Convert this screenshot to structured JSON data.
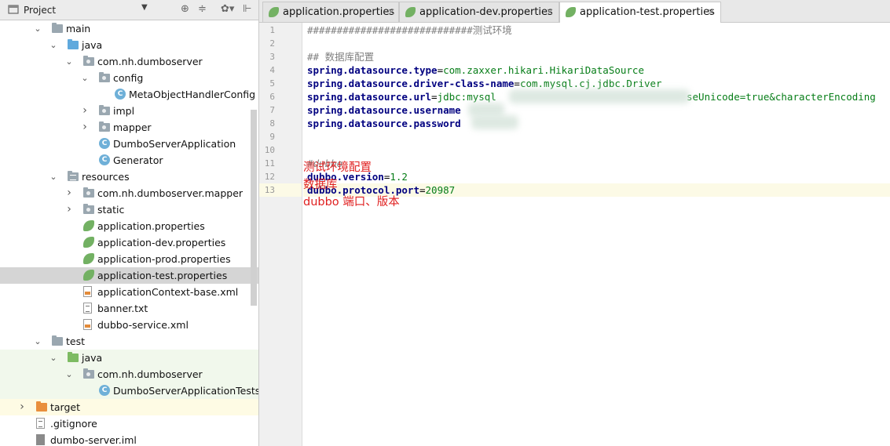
{
  "project_panel": {
    "title": "Project",
    "dropdown_glyph": "▼",
    "tools": [
      "⊕",
      "≑",
      "✿▾",
      "⊩"
    ],
    "tree": [
      {
        "label": "main",
        "indent": 1,
        "arrow": "open",
        "icon": "folder-gray"
      },
      {
        "label": "java",
        "indent": 2,
        "arrow": "open",
        "icon": "folder-blue"
      },
      {
        "label": "com.nh.dumboserver",
        "indent": 3,
        "arrow": "open",
        "icon": "package"
      },
      {
        "label": "config",
        "indent": 4,
        "arrow": "open",
        "icon": "package"
      },
      {
        "label": "MetaObjectHandlerConfig",
        "indent": 5,
        "arrow": "none",
        "icon": "class"
      },
      {
        "label": "impl",
        "indent": 4,
        "arrow": "closed",
        "icon": "package"
      },
      {
        "label": "mapper",
        "indent": 4,
        "arrow": "closed",
        "icon": "package"
      },
      {
        "label": "DumboServerApplication",
        "indent": 4,
        "arrow": "none",
        "icon": "class-spring"
      },
      {
        "label": "Generator",
        "indent": 4,
        "arrow": "none",
        "icon": "class"
      },
      {
        "label": "resources",
        "indent": 2,
        "arrow": "open",
        "icon": "folder-resources"
      },
      {
        "label": "com.nh.dumboserver.mapper",
        "indent": 3,
        "arrow": "closed",
        "icon": "package"
      },
      {
        "label": "static",
        "indent": 3,
        "arrow": "closed",
        "icon": "package"
      },
      {
        "label": "application.properties",
        "indent": 3,
        "arrow": "none",
        "icon": "spring-properties"
      },
      {
        "label": "application-dev.properties",
        "indent": 3,
        "arrow": "none",
        "icon": "spring-properties"
      },
      {
        "label": "application-prod.properties",
        "indent": 3,
        "arrow": "none",
        "icon": "spring-properties"
      },
      {
        "label": "application-test.properties",
        "indent": 3,
        "arrow": "none",
        "icon": "spring-properties",
        "selected": true
      },
      {
        "label": "applicationContext-base.xml",
        "indent": 3,
        "arrow": "none",
        "icon": "xml-file"
      },
      {
        "label": "banner.txt",
        "indent": 3,
        "arrow": "none",
        "icon": "text-file"
      },
      {
        "label": "dubbo-service.xml",
        "indent": 3,
        "arrow": "none",
        "icon": "xml-file"
      },
      {
        "label": "test",
        "indent": 1,
        "arrow": "open",
        "icon": "folder-gray"
      },
      {
        "label": "java",
        "indent": 2,
        "arrow": "open",
        "icon": "folder-green",
        "test": true
      },
      {
        "label": "com.nh.dumboserver",
        "indent": 3,
        "arrow": "open",
        "icon": "package",
        "test": true
      },
      {
        "label": "DumboServerApplicationTests",
        "indent": 4,
        "arrow": "none",
        "icon": "class-spring",
        "test": true
      },
      {
        "label": "target",
        "indent": 0,
        "arrow": "closed",
        "icon": "folder-orange",
        "excluded": true
      },
      {
        "label": ".gitignore",
        "indent": 0,
        "arrow": "none",
        "icon": "text-file"
      },
      {
        "label": "dumbo-server.iml",
        "indent": 0,
        "arrow": "none",
        "icon": "iml-file"
      }
    ]
  },
  "tabs": [
    {
      "label": "application.properties",
      "active": false
    },
    {
      "label": "application-dev.properties",
      "active": false
    },
    {
      "label": "application-test.properties",
      "active": true
    }
  ],
  "tab_close_glyph": "×",
  "editor": {
    "lines": [
      {
        "n": "1",
        "parts": [
          {
            "c": "cm",
            "t": "############################测试环境"
          }
        ]
      },
      {
        "n": "2",
        "parts": []
      },
      {
        "n": "3",
        "parts": [
          {
            "c": "cm",
            "t": "## 数据库配置"
          }
        ]
      },
      {
        "n": "4",
        "parts": [
          {
            "c": "k",
            "t": "spring.datasource.type"
          },
          {
            "c": "eq",
            "t": "="
          },
          {
            "c": "v",
            "t": "com.zaxxer.hikari.HikariDataSource"
          }
        ]
      },
      {
        "n": "5",
        "parts": [
          {
            "c": "k",
            "t": "spring.datasource.driver-class-name"
          },
          {
            "c": "eq",
            "t": "="
          },
          {
            "c": "v",
            "t": "com.mysql.cj.jdbc.Driver"
          }
        ]
      },
      {
        "n": "6",
        "parts": [
          {
            "c": "k",
            "t": "spring.datasource.url"
          },
          {
            "c": "eq",
            "t": "="
          },
          {
            "c": "v",
            "t": "jdbc:mysql"
          }
        ]
      },
      {
        "n": "7",
        "parts": [
          {
            "c": "k",
            "t": "spring.datasource.username"
          }
        ]
      },
      {
        "n": "8",
        "parts": [
          {
            "c": "k",
            "t": "spring.datasource.password"
          }
        ]
      },
      {
        "n": "9",
        "parts": []
      },
      {
        "n": "10",
        "parts": []
      },
      {
        "n": "11",
        "parts": [
          {
            "c": "cm-i",
            "t": "#dubbo"
          }
        ]
      },
      {
        "n": "12",
        "parts": [
          {
            "c": "k",
            "t": "dubbo.version"
          },
          {
            "c": "eq",
            "t": "="
          },
          {
            "c": "v",
            "t": "1.2"
          }
        ]
      },
      {
        "n": "13",
        "parts": [
          {
            "c": "k",
            "t": "dubbo.protocol.port"
          },
          {
            "c": "eq",
            "t": "="
          },
          {
            "c": "v",
            "t": "20987"
          }
        ],
        "current": true
      }
    ],
    "line6_tail": "seUnicode=true&characterEncoding"
  },
  "annotation": {
    "line1": "测试环境配置",
    "line2": "数据库",
    "line3": "dubbo 端口、版本"
  }
}
